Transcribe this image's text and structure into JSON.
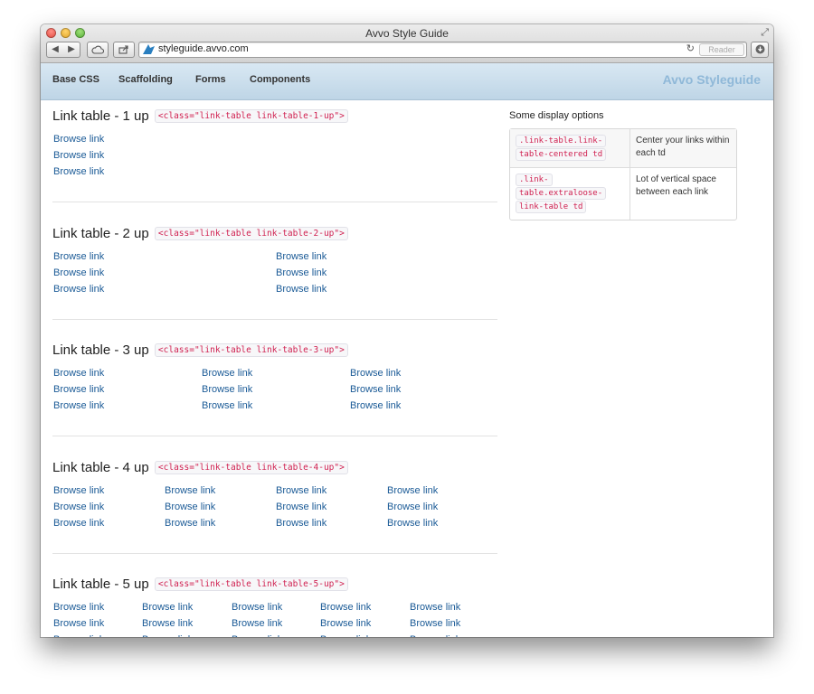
{
  "window": {
    "title": "Avvo Style Guide"
  },
  "toolbar": {
    "url": "styleguide.avvo.com",
    "reader_label": "Reader"
  },
  "icons": {
    "back": "back-arrow-icon",
    "forward": "forward-arrow-icon",
    "icloud": "cloud-icon",
    "share": "share-icon",
    "reload": "reload-icon",
    "download": "download-icon",
    "fullscreen": "fullscreen-icon"
  },
  "navbar": {
    "items": [
      "Base CSS",
      "Scaffolding",
      "Forms",
      "Components"
    ],
    "brand": "Avvo Styleguide"
  },
  "sections": [
    {
      "title": "Link table - 1 up",
      "code": "<class=\"link-table link-table-1-up\">",
      "columns": 1,
      "rows": [
        [
          "Browse link"
        ],
        [
          "Browse link"
        ],
        [
          "Browse link"
        ]
      ]
    },
    {
      "title": "Link table - 2 up",
      "code": "<class=\"link-table link-table-2-up\">",
      "columns": 2,
      "rows": [
        [
          "Browse link",
          "Browse link"
        ],
        [
          "Browse link",
          "Browse link"
        ],
        [
          "Browse link",
          "Browse link"
        ]
      ]
    },
    {
      "title": "Link table - 3 up",
      "code": "<class=\"link-table link-table-3-up\">",
      "columns": 3,
      "rows": [
        [
          "Browse link",
          "Browse link",
          "Browse link"
        ],
        [
          "Browse link",
          "Browse link",
          "Browse link"
        ],
        [
          "Browse link",
          "Browse link",
          "Browse link"
        ]
      ]
    },
    {
      "title": "Link table - 4 up",
      "code": "<class=\"link-table link-table-4-up\">",
      "columns": 4,
      "rows": [
        [
          "Browse link",
          "Browse link",
          "Browse link",
          "Browse link"
        ],
        [
          "Browse link",
          "Browse link",
          "Browse link",
          "Browse link"
        ],
        [
          "Browse link",
          "Browse link",
          "Browse link",
          "Browse link"
        ]
      ]
    },
    {
      "title": "Link table - 5 up",
      "code": "<class=\"link-table link-table-5-up\">",
      "columns": 5,
      "rows": [
        [
          "Browse link",
          "Browse link",
          "Browse link",
          "Browse link",
          "Browse link"
        ],
        [
          "Browse link",
          "Browse link",
          "Browse link",
          "Browse link",
          "Browse link"
        ],
        [
          "Browse link",
          "Browse link",
          "Browse link",
          "Browse link",
          "Browse link"
        ]
      ]
    }
  ],
  "sidebar": {
    "title": "Some display options",
    "options": [
      {
        "class": ".link-table.link-table-centered td",
        "description": "Center your links within each td"
      },
      {
        "class": ".link-table.extraloose-link-table td",
        "description": "Lot of vertical space between each link"
      }
    ]
  },
  "colors": {
    "link": "#1a5a96",
    "code": "#d02050",
    "brand": "#8fb8d8",
    "navbar": "#c9dcea"
  }
}
